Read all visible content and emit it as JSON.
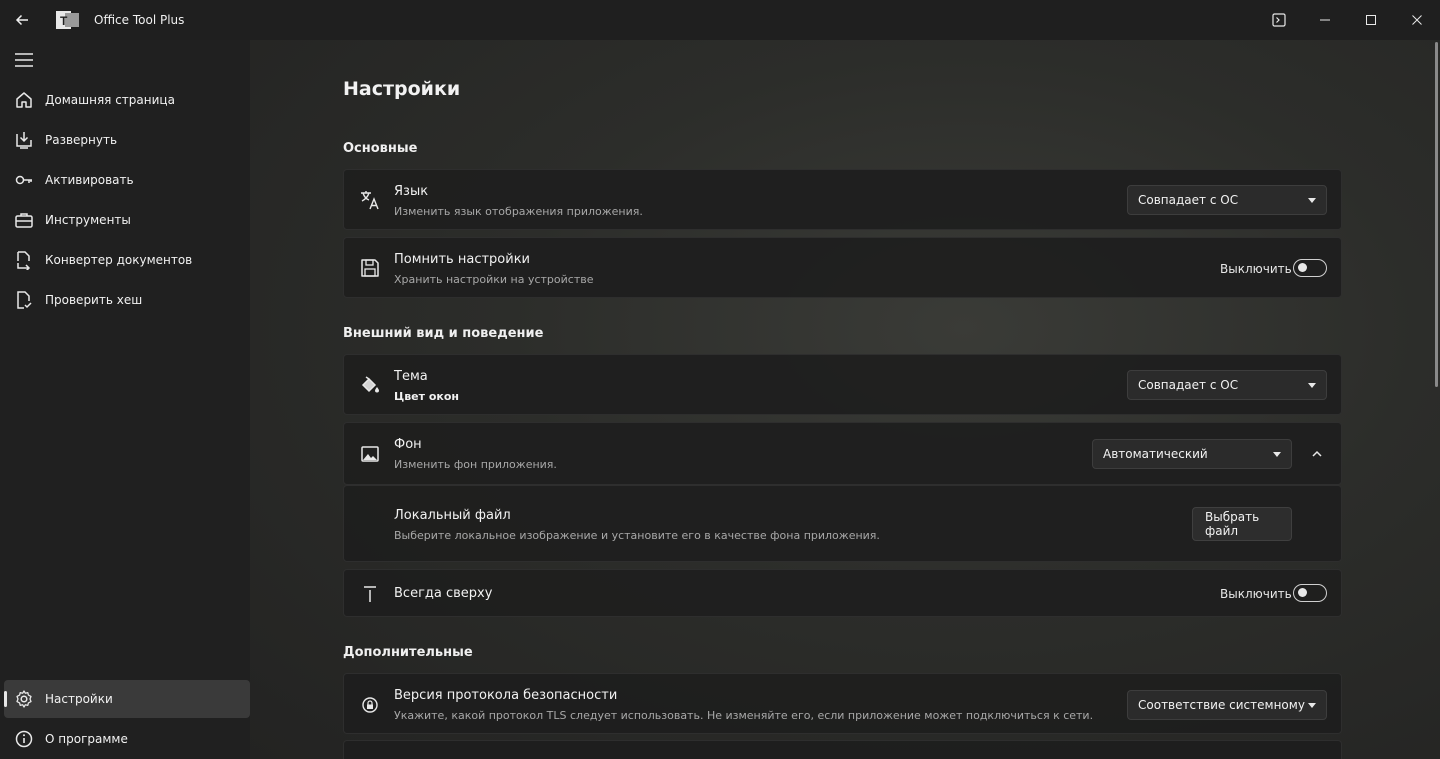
{
  "app": {
    "title": "Office Tool Plus",
    "logo_text": "T"
  },
  "sidebar": {
    "items": [
      {
        "label": "Домашняя страница",
        "icon": "home-icon"
      },
      {
        "label": "Развернуть",
        "icon": "download-icon"
      },
      {
        "label": "Активировать",
        "icon": "key-icon"
      },
      {
        "label": "Инструменты",
        "icon": "toolbox-icon"
      },
      {
        "label": "Конвертер документов",
        "icon": "document-convert-icon"
      },
      {
        "label": "Проверить хеш",
        "icon": "document-check-icon"
      }
    ],
    "footer": [
      {
        "label": "Настройки",
        "icon": "gear-icon",
        "selected": true
      },
      {
        "label": "О программе",
        "icon": "info-icon"
      }
    ]
  },
  "page": {
    "title": "Настройки"
  },
  "sections": {
    "basic": "Основные",
    "appearance": "Внешний вид и поведение",
    "additional": "Дополнительные"
  },
  "settings": {
    "language": {
      "title": "Язык",
      "desc": "Изменить язык отображения приложения.",
      "value": "Совпадает с ОС"
    },
    "remember": {
      "title": "Помнить настройки",
      "desc": "Хранить настройки на устройстве",
      "toggle_label": "Выключить"
    },
    "theme": {
      "title": "Тема",
      "desc": "Цвет окон",
      "value": "Совпадает с ОС"
    },
    "background": {
      "title": "Фон",
      "desc": "Изменить фон приложения.",
      "value": "Автоматический"
    },
    "local_file": {
      "title": "Локальный файл",
      "desc": "Выберите локальное изображение и установите его в качестве фона приложения.",
      "button": "Выбрать файл"
    },
    "always_on_top": {
      "title": "Всегда сверху",
      "toggle_label": "Выключить"
    },
    "tls": {
      "title": "Версия протокола безопасности",
      "desc": "Укажите, какой протокол TLS следует использовать. Не изменяйте его, если приложение может подключиться к сети.",
      "value": "Соответствие системному"
    }
  }
}
